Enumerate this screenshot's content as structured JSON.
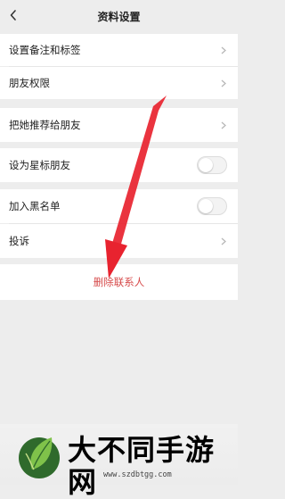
{
  "header": {
    "title": "资料设置",
    "back_icon": "chevron-left-icon"
  },
  "rows": [
    {
      "label": "设置备注和标签",
      "control": "chevron"
    },
    {
      "label": "朋友权限",
      "control": "chevron"
    },
    {
      "label": "把她推荐给朋友",
      "control": "chevron"
    },
    {
      "label": "设为星标朋友",
      "control": "toggle",
      "on": false
    },
    {
      "label": "加入黑名单",
      "control": "toggle",
      "on": false
    },
    {
      "label": "投诉",
      "control": "chevron"
    }
  ],
  "delete_label": "删除联系人",
  "colors": {
    "background": "#ededed",
    "delete_text": "#d64a4a",
    "annotation_arrow": "#e8232f"
  },
  "watermark": {
    "site_name": "大不同手游网",
    "url": "www.szdbtgg.com"
  }
}
